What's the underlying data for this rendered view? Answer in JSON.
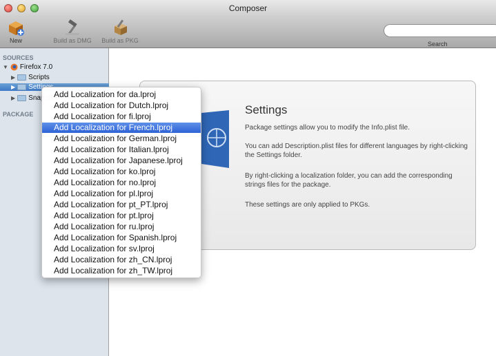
{
  "window": {
    "title": "Composer"
  },
  "toolbar": {
    "new_label": "New",
    "build_dmg_label": "Build as DMG",
    "build_pkg_label": "Build as PKG",
    "search_label": "Search",
    "search_value": ""
  },
  "sidebar": {
    "sources_header": "SOURCES",
    "package_header": "PACKAGE",
    "items": [
      {
        "label": "Firefox 7.0"
      },
      {
        "label": "Scripts"
      },
      {
        "label": "Settings"
      },
      {
        "label": "Snapshot"
      }
    ]
  },
  "panel": {
    "title": "Settings",
    "paragraphs": [
      "Package settings allow you to modify the Info.plist file.",
      "You can add Description.plist files for different languages by right-clicking the Settings folder.",
      "By right-clicking a localization folder, you can add the corresponding strings files for the package.",
      "These settings are only applied to PKGs."
    ]
  },
  "context_menu": {
    "highlighted_index": 3,
    "items": [
      "Add Localization for da.lproj",
      "Add Localization for Dutch.lproj",
      "Add Localization for fi.lproj",
      "Add Localization for French.lproj",
      "Add Localization for German.lproj",
      "Add Localization for Italian.lproj",
      "Add Localization for Japanese.lproj",
      "Add Localization for ko.lproj",
      "Add Localization for no.lproj",
      "Add Localization for pl.lproj",
      "Add Localization for pt_PT.lproj",
      "Add Localization for pt.lproj",
      "Add Localization for ru.lproj",
      "Add Localization for Spanish.lproj",
      "Add Localization for sv.lproj",
      "Add Localization for zh_CN.lproj",
      "Add Localization for zh_TW.lproj"
    ]
  },
  "colors": {
    "selection": "#3e78c3",
    "menu_highlight": "#2e63d6",
    "sidebar_bg": "#dde4ec"
  }
}
